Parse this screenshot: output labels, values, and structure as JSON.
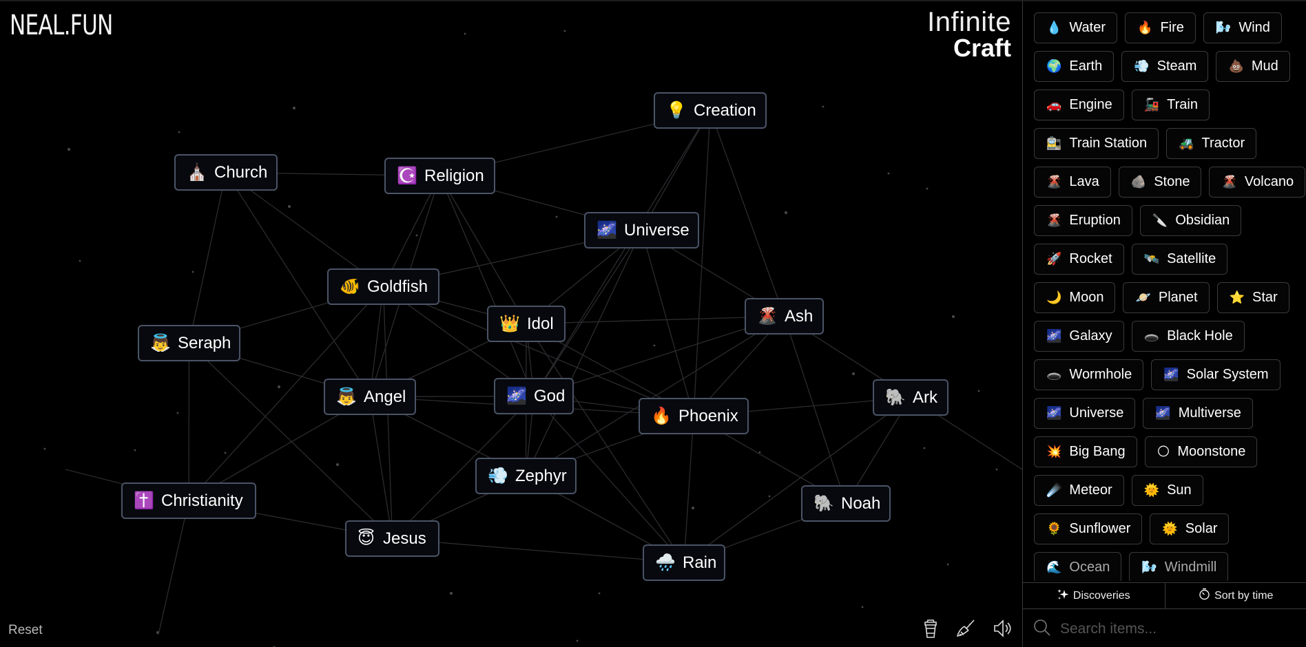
{
  "header": {
    "logo": "NEAL.FUN",
    "title_line1": "Infinite",
    "title_line2": "Craft"
  },
  "canvas": {
    "nodes": [
      {
        "id": "creation",
        "label": "Creation",
        "emoji": "💡"
      },
      {
        "id": "church",
        "label": "Church",
        "emoji": "⛪"
      },
      {
        "id": "religion",
        "label": "Religion",
        "emoji": "☪️"
      },
      {
        "id": "universe",
        "label": "Universe",
        "emoji": "🌌"
      },
      {
        "id": "goldfish",
        "label": "Goldfish",
        "emoji": "🐠"
      },
      {
        "id": "idol",
        "label": "Idol",
        "emoji": "👑"
      },
      {
        "id": "ash",
        "label": "Ash",
        "emoji": "🌋"
      },
      {
        "id": "seraph",
        "label": "Seraph",
        "emoji": "👼"
      },
      {
        "id": "god",
        "label": "God",
        "emoji": "🌌"
      },
      {
        "id": "angel",
        "label": "Angel",
        "emoji": "👼"
      },
      {
        "id": "phoenix",
        "label": "Phoenix",
        "emoji": "🔥"
      },
      {
        "id": "ark",
        "label": "Ark",
        "emoji": "🐘"
      },
      {
        "id": "zephyr",
        "label": "Zephyr",
        "emoji": "💨"
      },
      {
        "id": "noah",
        "label": "Noah",
        "emoji": "🐘"
      },
      {
        "id": "christianity",
        "label": "Christianity",
        "emoji": "✝️"
      },
      {
        "id": "jesus",
        "label": "Jesus",
        "emoji": "😇"
      },
      {
        "id": "rain",
        "label": "Rain",
        "emoji": "🌧️"
      }
    ],
    "reset_label": "Reset",
    "tools": [
      {
        "name": "coffee-cup-icon"
      },
      {
        "name": "broom-icon"
      },
      {
        "name": "speaker-icon"
      }
    ]
  },
  "sidebar": {
    "items": [
      [
        {
          "label": "Water",
          "emoji": "💧"
        },
        {
          "label": "Fire",
          "emoji": "🔥"
        },
        {
          "label": "Wind",
          "emoji": "🌬️"
        }
      ],
      [
        {
          "label": "Earth",
          "emoji": "🌍"
        },
        {
          "label": "Steam",
          "emoji": "💨"
        },
        {
          "label": "Mud",
          "emoji": "💩"
        }
      ],
      [
        {
          "label": "Engine",
          "emoji": "🚗"
        },
        {
          "label": "Train",
          "emoji": "🚂"
        }
      ],
      [
        {
          "label": "Train Station",
          "emoji": "🚉"
        },
        {
          "label": "Tractor",
          "emoji": "🚜"
        }
      ],
      [
        {
          "label": "Lava",
          "emoji": "🌋"
        },
        {
          "label": "Stone",
          "emoji": "🪨"
        },
        {
          "label": "Volcano",
          "emoji": "🌋"
        }
      ],
      [
        {
          "label": "Eruption",
          "emoji": "🌋"
        },
        {
          "label": "Obsidian",
          "emoji": "🔪"
        }
      ],
      [
        {
          "label": "Rocket",
          "emoji": "🚀"
        },
        {
          "label": "Satellite",
          "emoji": "🛰️"
        }
      ],
      [
        {
          "label": "Moon",
          "emoji": "🌙"
        },
        {
          "label": "Planet",
          "emoji": "🪐"
        },
        {
          "label": "Star",
          "emoji": "⭐"
        }
      ],
      [
        {
          "label": "Galaxy",
          "emoji": "🌌"
        },
        {
          "label": "Black Hole",
          "emoji": "🕳️"
        }
      ],
      [
        {
          "label": "Wormhole",
          "emoji": "🕳️"
        },
        {
          "label": "Solar System",
          "emoji": "🌌"
        }
      ],
      [
        {
          "label": "Universe",
          "emoji": "🌌"
        },
        {
          "label": "Multiverse",
          "emoji": "🌌"
        }
      ],
      [
        {
          "label": "Big Bang",
          "emoji": "💥"
        },
        {
          "label": "Moonstone",
          "emoji": "🌕"
        }
      ],
      [
        {
          "label": "Meteor",
          "emoji": "☄️"
        },
        {
          "label": "Sun",
          "emoji": "🌞"
        }
      ],
      [
        {
          "label": "Sunflower",
          "emoji": "🌻"
        },
        {
          "label": "Solar",
          "emoji": "🌞"
        }
      ],
      [
        {
          "label": "Ocean",
          "emoji": "🌊"
        },
        {
          "label": "Windmill",
          "emoji": "🌬️"
        }
      ]
    ],
    "tabs": [
      {
        "label": "Discoveries",
        "icon": "sparkles-icon"
      },
      {
        "label": "Sort by time",
        "icon": "stopwatch-icon"
      }
    ],
    "search": {
      "placeholder": "Search items...",
      "value": ""
    }
  }
}
